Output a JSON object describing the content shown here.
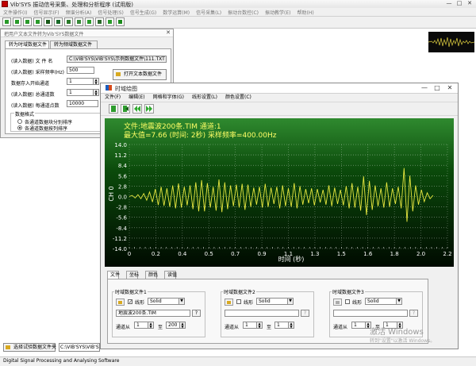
{
  "app": {
    "title": "Vib'SYS 振动信号采集、处理和分析程序 (试用版)",
    "win_min": "—",
    "win_max": "□",
    "win_close": "✕"
  },
  "menubar": [
    "文件操作(I)",
    "信号显示(F)",
    "频谱分析(A)",
    "信号处理(S)",
    "信号生成(G)",
    "数学运算(M)",
    "信号采集(L)",
    "振动台数控(C)",
    "振动教学(E)",
    "帮助(H)"
  ],
  "import_window": {
    "title": "把用户文本文件转为Vib'SYS数据文件",
    "close": "✕",
    "tabs": [
      "转为时域数据文件",
      "转为频域数据文件"
    ],
    "labels": {
      "file_name": "(读入数据) 文 件 名",
      "sample_rate": "(读入数据) 采样频率(Hz)",
      "start_channel": "数据存入开始通道",
      "total_channels": "(读入数据) 总通道数",
      "points_per_channel": "(读入数据) 每通道点数",
      "format_group": "数据格式",
      "format_option1": "各通道数据块分别排序",
      "format_option2": "各通道数据按列排序"
    },
    "values": {
      "file_name": "C:\\VIB'SYS\\VIB'SYS\\示例数据文件\\111.TXT",
      "sample_rate": "500",
      "start_channel": "1",
      "total_channels": "1",
      "points_per_channel": "10000"
    },
    "open_button": "打开文本数据文件",
    "selected_format": 2
  },
  "time_window": {
    "title": "时域绘图",
    "close": "✕",
    "minimize": "—",
    "maximize": "□",
    "menu": [
      "文件(F)",
      "编辑(E)",
      "网格和字体(G)",
      "线形设置(L)",
      "颜色设置(C)"
    ],
    "tabs": [
      "文件",
      "坐标",
      "颜色",
      "读值"
    ],
    "files": [
      {
        "group": "时域数据文件1",
        "style": "Solid",
        "checked": true,
        "file": "地震波200条.TIM",
        "help": "?",
        "from_label": "通道从",
        "to_label": "至",
        "from": "1",
        "to": "200"
      },
      {
        "group": "时域数据文件2",
        "style": "Solid",
        "checked": false,
        "file": "",
        "help": "?",
        "from_label": "通道从",
        "to_label": "至",
        "from": "1",
        "to": "1"
      },
      {
        "group": "时域数据文件3",
        "style": "Solid",
        "checked": false,
        "file": "",
        "help": "?",
        "from_label": "通道从",
        "to_label": "至",
        "from": "1",
        "to": "1"
      }
    ],
    "line_label": "线形"
  },
  "bottom": {
    "select_button": "选择试验数据文件夹",
    "path": "C:\\VIB'SYS\\VIB'SYS\\",
    "status": "Digital Signal Processing and Analysing Software"
  },
  "watermark": {
    "line1": "激活 Windows",
    "line2": "转到\"设置\"以激活 Windows。"
  },
  "chart_data": {
    "type": "line",
    "info_line1": "文件:地震波200条.TIM 通道:1",
    "info_line2": "最大值=7.66 (时间:    2秒) 采样频率=400.00Hz",
    "ylabel": "CH 0",
    "xlabel": "时间 (秒)",
    "xlim": [
      0,
      2.2
    ],
    "ylim": [
      -14,
      14
    ],
    "xticks": [
      "0",
      "0.2",
      "0.4",
      "0.5",
      "0.7",
      "0.9",
      "1.1",
      "1.3",
      "1.5",
      "1.6",
      "1.8",
      "2.0",
      "2.2"
    ],
    "yticks": [
      "14.0",
      "11.2",
      "8.4",
      "5.6",
      "2.8",
      "0.0",
      "-2.8",
      "-5.6",
      "-8.4",
      "-11.2",
      "-14.0"
    ],
    "line_color": "#e8e840",
    "grid": true,
    "series": [
      {
        "x": [
          0,
          0.02,
          0.04,
          0.06,
          0.08,
          0.1,
          0.12,
          0.14,
          0.16,
          0.18,
          0.2,
          0.22,
          0.24,
          0.26,
          0.28,
          0.3,
          0.32,
          0.34,
          0.36,
          0.38,
          0.4,
          0.42,
          0.44,
          0.46,
          0.48,
          0.5,
          0.52,
          0.54,
          0.56,
          0.58,
          0.6,
          0.62,
          0.64,
          0.66,
          0.68,
          0.7,
          0.72,
          0.74,
          0.76,
          0.78,
          0.8,
          0.82,
          0.84,
          0.86,
          0.88,
          0.9,
          0.92,
          0.94,
          0.96,
          0.98,
          1.0,
          1.02,
          1.04,
          1.06,
          1.08,
          1.1,
          1.12,
          1.14,
          1.16,
          1.18,
          1.2,
          1.22,
          1.24,
          1.26,
          1.28,
          1.3,
          1.32,
          1.34,
          1.36,
          1.38,
          1.4,
          1.42,
          1.44,
          1.46,
          1.48,
          1.5,
          1.52,
          1.54,
          1.56,
          1.58,
          1.6,
          1.62,
          1.64,
          1.66,
          1.68,
          1.7,
          1.72,
          1.74,
          1.76,
          1.78,
          1.8,
          1.82,
          1.84,
          1.86,
          1.88,
          1.9,
          1.92,
          1.94,
          1.96,
          1.98,
          2.0,
          2.02,
          2.04,
          2.06,
          2.08,
          2.1
        ],
        "values": [
          0,
          0.3,
          -0.4,
          0.5,
          -0.6,
          0.8,
          -1.0,
          1.2,
          -1.5,
          2.0,
          -2.3,
          2.6,
          -2.5,
          2.2,
          -2.8,
          3.0,
          -3.2,
          3.5,
          -3.0,
          2.6,
          -2.4,
          3.0,
          -3.4,
          3.8,
          -4.0,
          4.4,
          -4.0,
          3.6,
          -3.0,
          2.6,
          -3.8,
          4.6,
          -4.2,
          3.8,
          -3.4,
          3.0,
          -2.6,
          3.2,
          -3.0,
          3.4,
          -3.6,
          3.2,
          -2.8,
          2.4,
          -2.2,
          2.6,
          -3.0,
          3.4,
          -2.8,
          2.4,
          -2.0,
          2.6,
          -3.2,
          3.0,
          -2.6,
          2.2,
          -2.8,
          3.6,
          -3.2,
          2.8,
          -2.2,
          2.0,
          -1.8,
          2.2,
          -2.4,
          2.0,
          -1.6,
          1.8,
          -2.2,
          3.0,
          -2.6,
          2.4,
          -2.0,
          1.8,
          -2.4,
          2.8,
          -3.2,
          3.6,
          -3.0,
          2.6,
          -3.8,
          5.4,
          -5.0,
          4.2,
          -3.6,
          3.0,
          -2.6,
          2.2,
          -3.0,
          3.8,
          -2.8,
          2.2,
          -2.0,
          2.6,
          -3.2,
          7.66,
          -6.8,
          5.6,
          -4.0,
          3.0,
          -2.2,
          1.8,
          -1.4,
          1.0,
          -0.6,
          0.3
        ]
      }
    ]
  }
}
